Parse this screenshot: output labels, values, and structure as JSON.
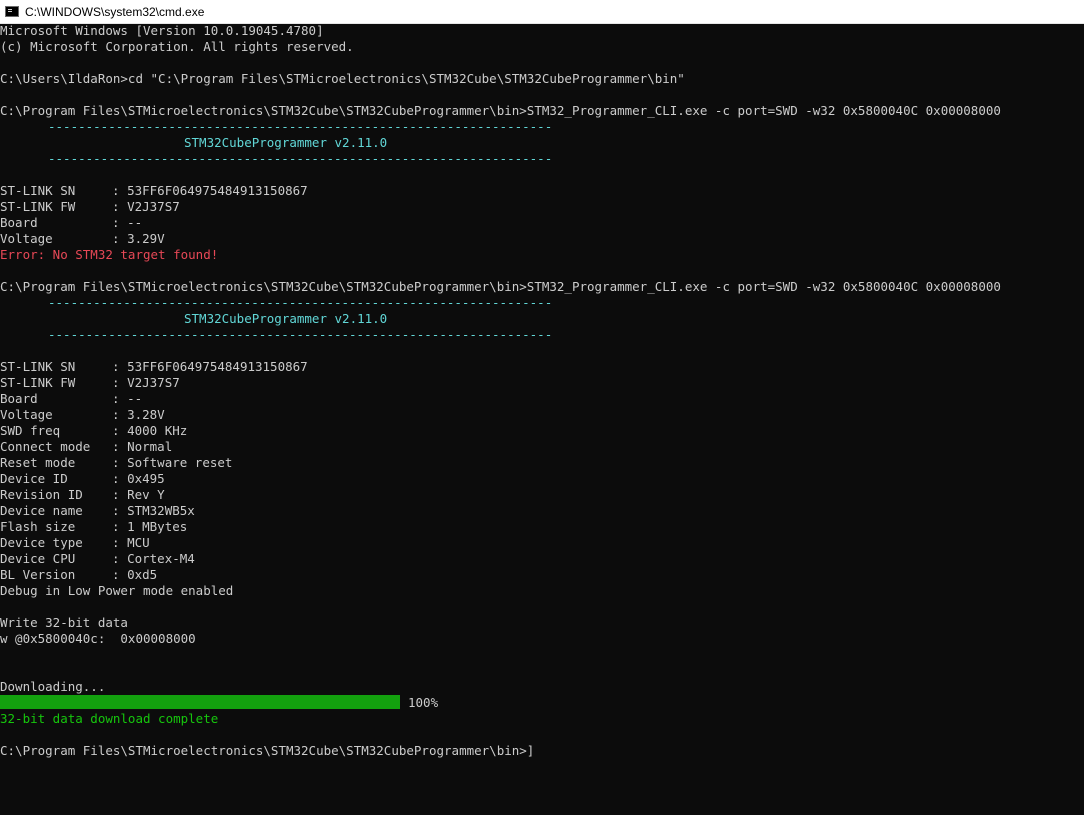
{
  "window": {
    "title": "C:\\WINDOWS\\system32\\cmd.exe"
  },
  "console": {
    "header_line1": "Microsoft Windows [Version 10.0.19045.4780]",
    "header_line2": "(c) Microsoft Corporation. All rights reserved.",
    "cmd1": "C:\\Users\\IldaRon>cd \"C:\\Program Files\\STMicroelectronics\\STM32Cube\\STM32CubeProgrammer\\bin\"",
    "separator": "-------------------------------------------------------------------",
    "banner": "STM32CubeProgrammer v2.11.0",
    "cmd2": "C:\\Program Files\\STMicroelectronics\\STM32Cube\\STM32CubeProgrammer\\bin>STM32_Programmer_CLI.exe -c port=SWD -w32 0x5800040C 0x00008000",
    "run1": {
      "info": [
        {
          "key": "ST-LINK SN",
          "value": "53FF6F064975484913150867"
        },
        {
          "key": "ST-LINK FW",
          "value": "V2J37S7"
        },
        {
          "key": "Board",
          "value": "--"
        },
        {
          "key": "Voltage",
          "value": "3.29V"
        }
      ],
      "error": "Error: No STM32 target found!"
    },
    "cmd3": "C:\\Program Files\\STMicroelectronics\\STM32Cube\\STM32CubeProgrammer\\bin>STM32_Programmer_CLI.exe -c port=SWD -w32 0x5800040C 0x00008000",
    "run2": {
      "info": [
        {
          "key": "ST-LINK SN",
          "value": "53FF6F064975484913150867"
        },
        {
          "key": "ST-LINK FW",
          "value": "V2J37S7"
        },
        {
          "key": "Board",
          "value": "--"
        },
        {
          "key": "Voltage",
          "value": "3.28V"
        },
        {
          "key": "SWD freq",
          "value": "4000 KHz"
        },
        {
          "key": "Connect mode",
          "value": "Normal"
        },
        {
          "key": "Reset mode",
          "value": "Software reset"
        },
        {
          "key": "Device ID",
          "value": "0x495"
        },
        {
          "key": "Revision ID",
          "value": "Rev Y"
        },
        {
          "key": "Device name",
          "value": "STM32WB5x"
        },
        {
          "key": "Flash size",
          "value": "1 MBytes"
        },
        {
          "key": "Device type",
          "value": "MCU"
        },
        {
          "key": "Device CPU",
          "value": "Cortex-M4"
        },
        {
          "key": "BL Version",
          "value": "0xd5"
        }
      ],
      "debug_line": "Debug in Low Power mode enabled",
      "write_header": "Write 32-bit data",
      "write_line": "w @0x5800040c:  0x00008000",
      "downloading": "Downloading...",
      "progress_percent": 100,
      "progress_label": "100%",
      "complete": "32-bit data download complete"
    },
    "prompt": "C:\\Program Files\\STMicroelectronics\\STM32Cube\\STM32CubeProgrammer\\bin>]"
  },
  "colors": {
    "background": "#0c0c0c",
    "text": "#cccccc",
    "cyan": "#61d6d6",
    "error_red": "#e74856",
    "success_green": "#16c60c",
    "progress_green": "#13a10e"
  }
}
